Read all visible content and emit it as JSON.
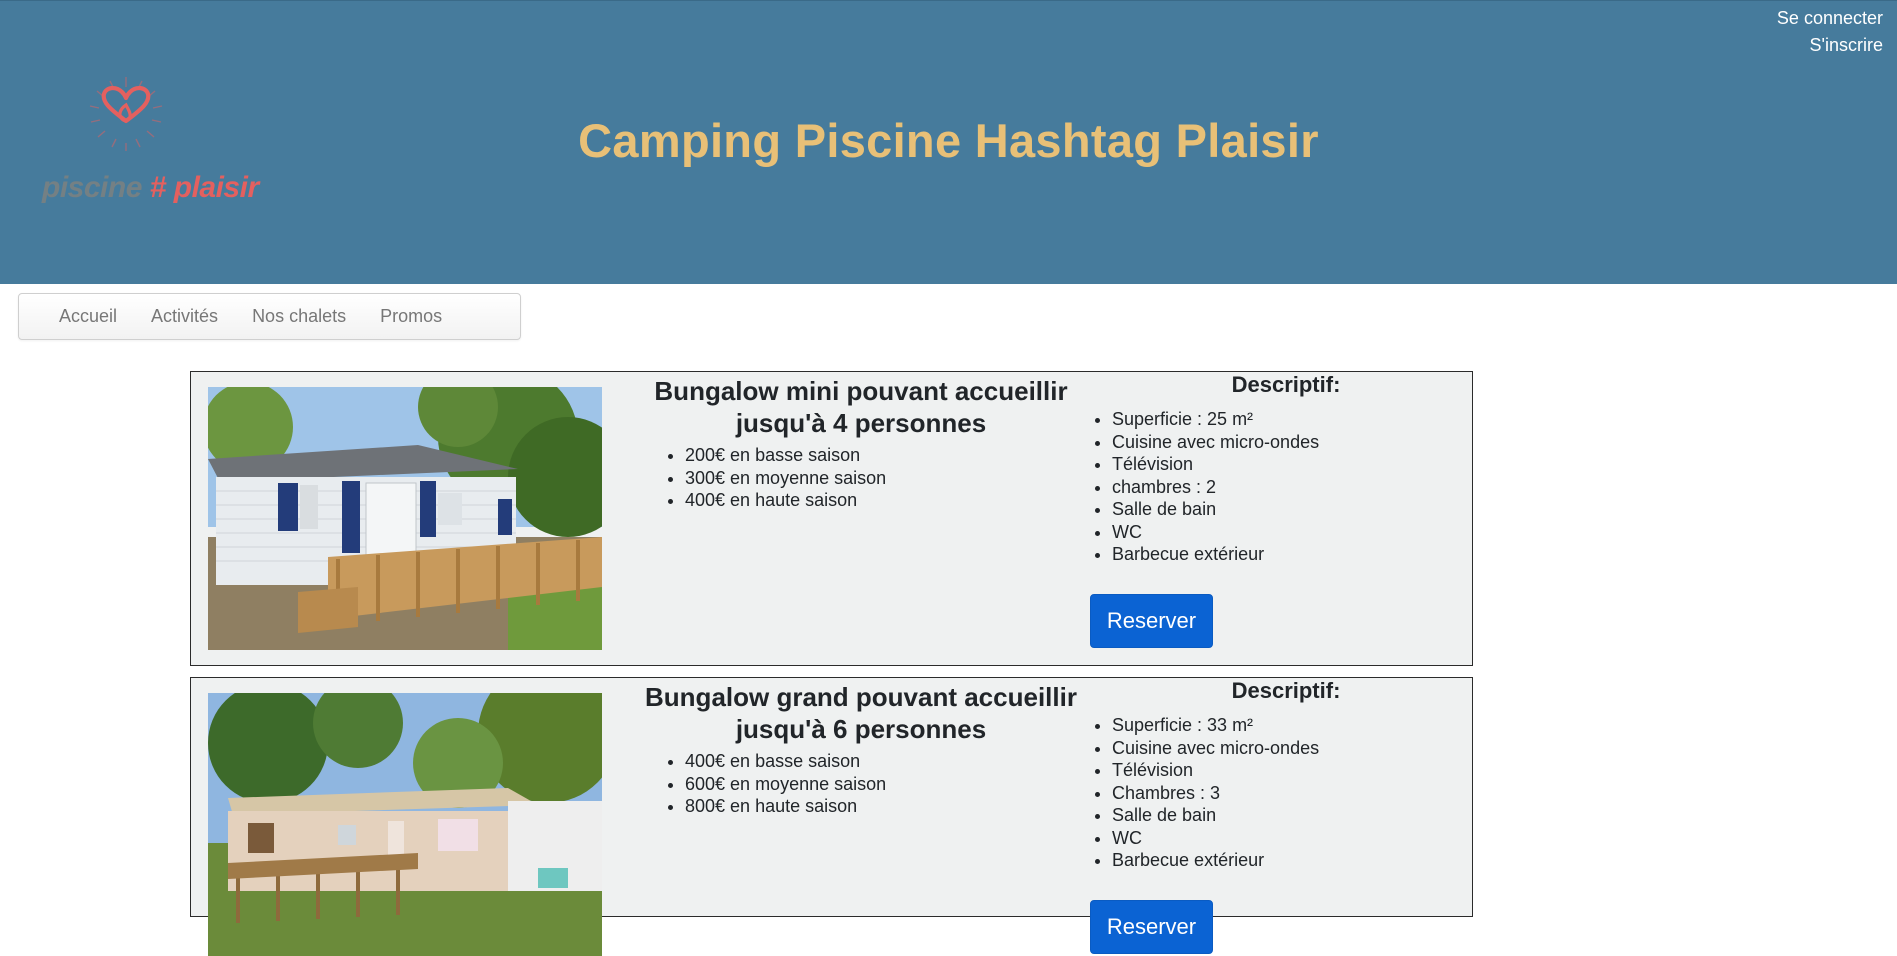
{
  "header": {
    "login_label": "Se connecter",
    "register_label": "S'inscrire",
    "site_title": "Camping Piscine Hashtag Plaisir",
    "logo": {
      "word1": "piscine",
      "hash": "#",
      "word2": "plaisir",
      "icon": "heart-sun-icon"
    }
  },
  "nav": {
    "items": [
      {
        "label": "Accueil"
      },
      {
        "label": "Activités"
      },
      {
        "label": "Nos chalets"
      },
      {
        "label": "Promos"
      }
    ]
  },
  "chalets": [
    {
      "title": "Bungalow mini pouvant accueillir jusqu'à 4 personnes",
      "prices": [
        "200€ en basse saison",
        "300€ en moyenne saison",
        "400€ en haute saison"
      ],
      "desc_title": "Descriptif:",
      "features": [
        "Superficie : 25 m²",
        "Cuisine avec micro-ondes",
        "Télévision",
        "chambres : 2",
        "Salle de bain",
        "WC",
        "Barbecue extérieur"
      ],
      "button_label": "Reserver"
    },
    {
      "title": "Bungalow grand pouvant accueillir jusqu'à 6 personnes",
      "prices": [
        "400€ en basse saison",
        "600€ en moyenne saison",
        "800€ en haute saison"
      ],
      "desc_title": "Descriptif:",
      "features": [
        "Superficie : 33 m²",
        "Cuisine avec micro-ondes",
        "Télévision",
        "Chambres : 3",
        "Salle de bain",
        "WC",
        "Barbecue extérieur"
      ],
      "button_label": "Reserver"
    }
  ],
  "colors": {
    "header_bg": "#467b9c",
    "title_gold": "#e8c077",
    "card_bg": "#eff1f1",
    "button_blue": "#0b63d3",
    "logo_red": "#e4605f"
  }
}
